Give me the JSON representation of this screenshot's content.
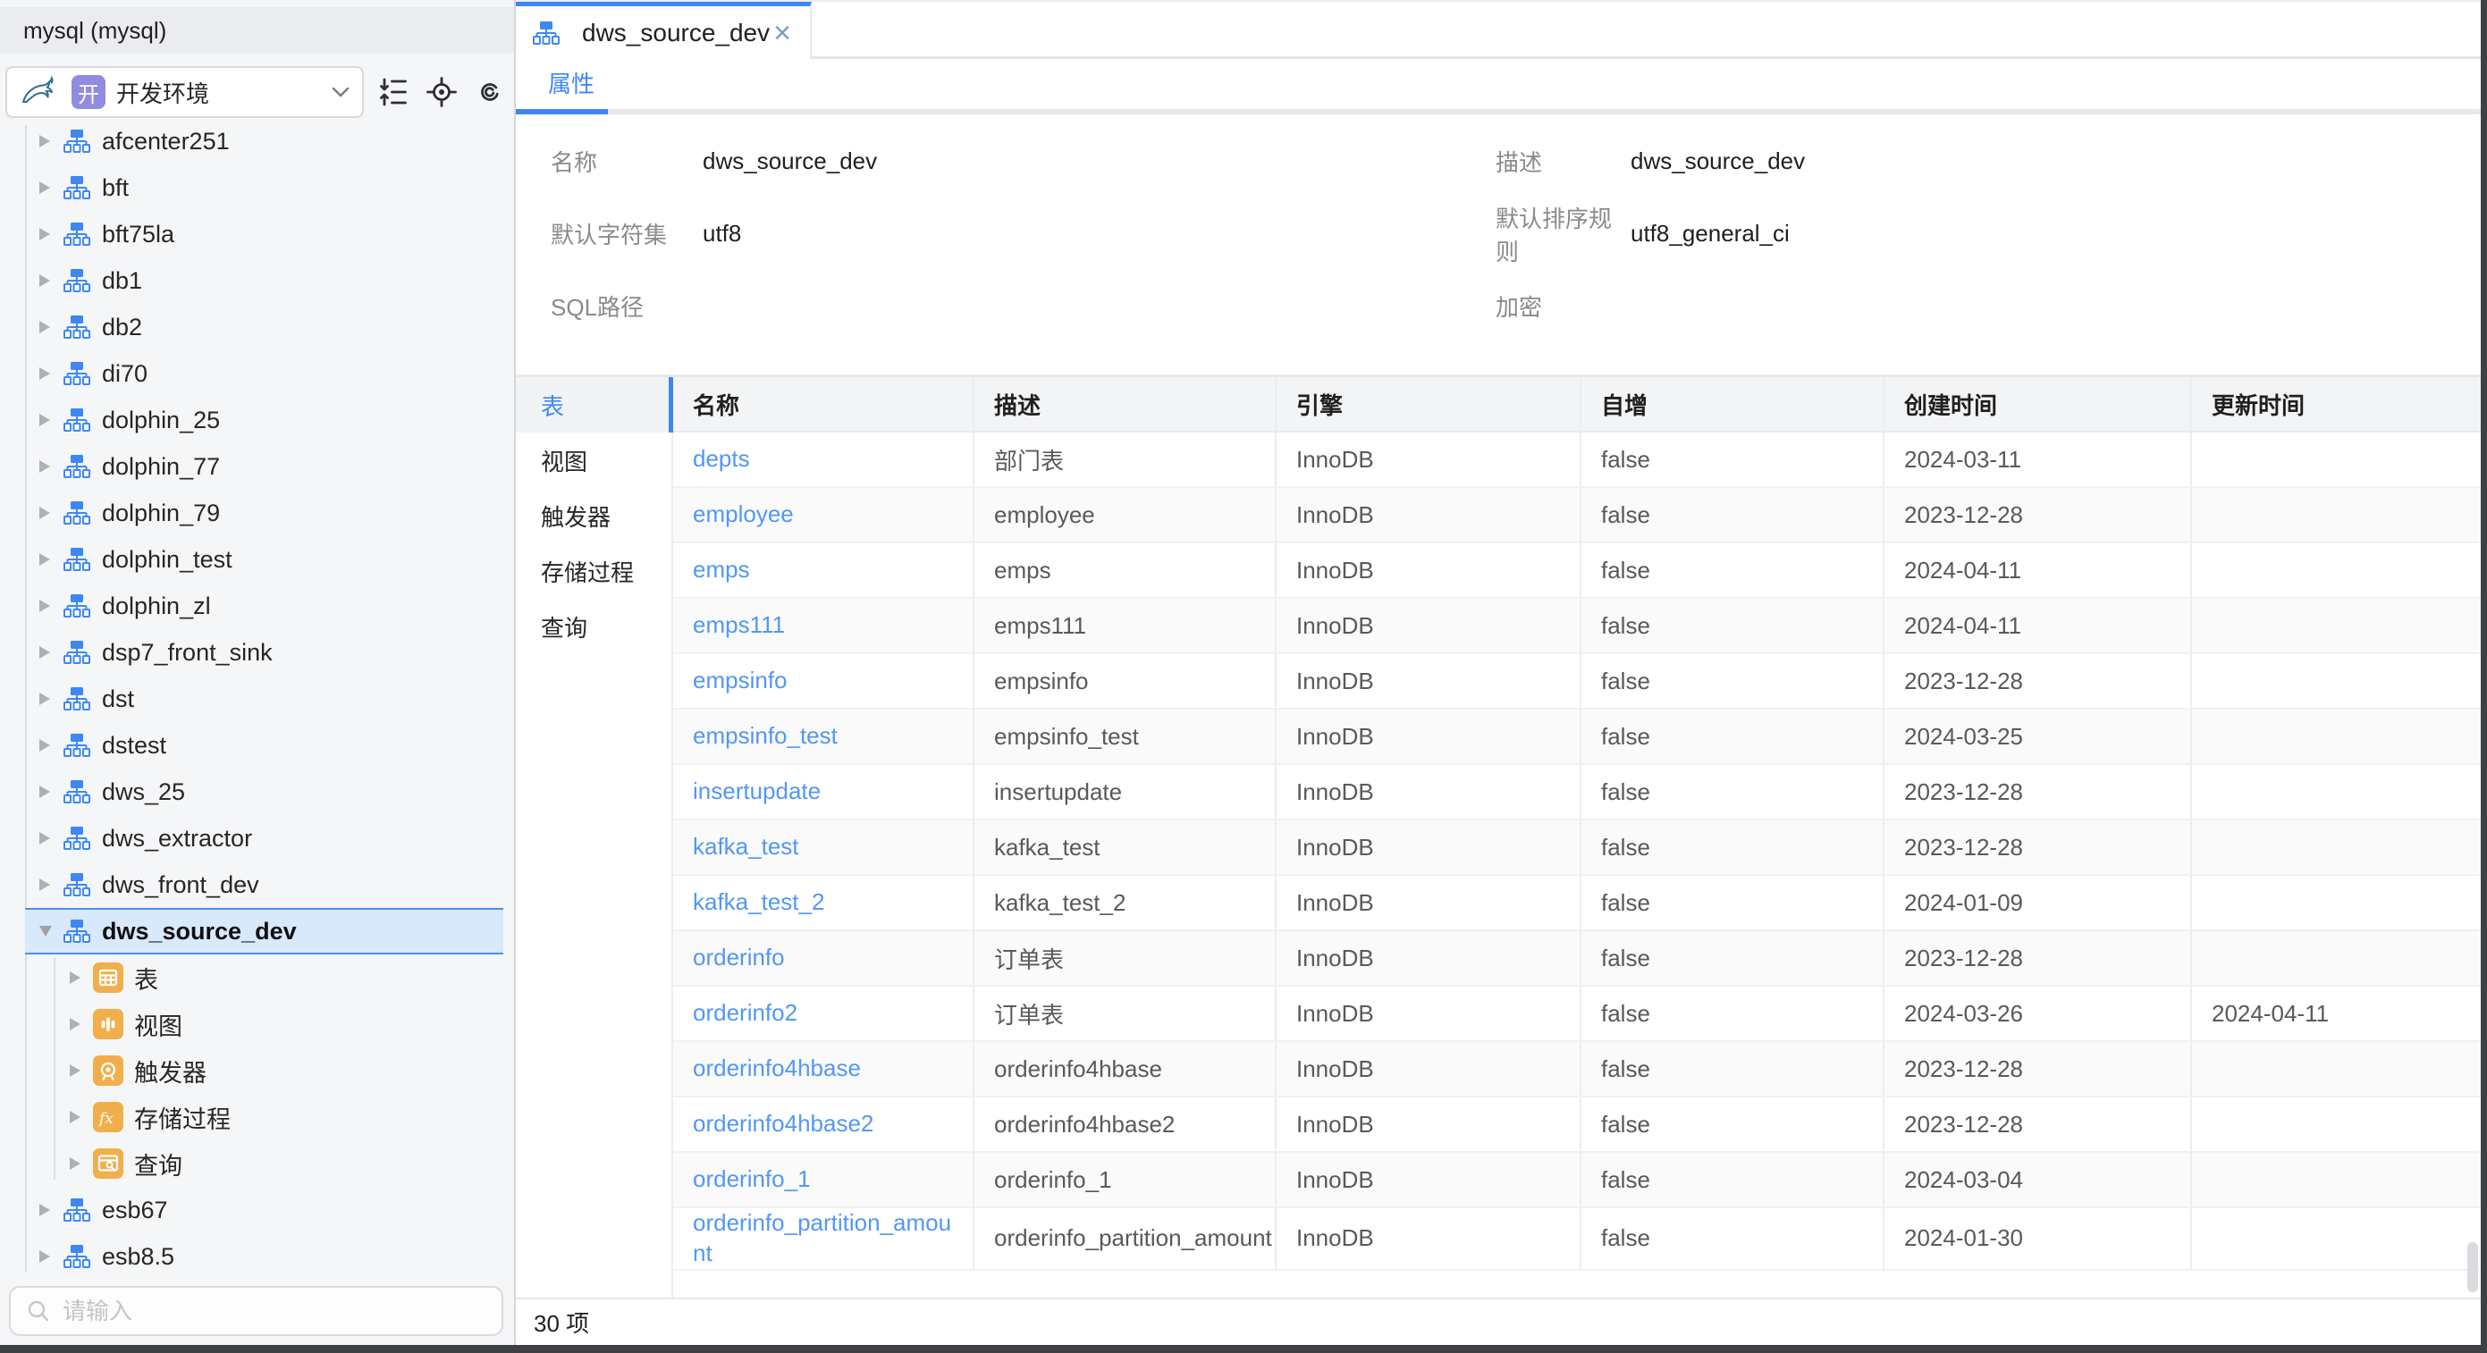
{
  "colors": {
    "accent": "#3D87F5",
    "link": "#5297F5",
    "selection_bg": "#D8E9FC",
    "icon_orange": "#F1AF4B",
    "badge_purple": "#918CE0"
  },
  "sidebar": {
    "header": "mysql (mysql)",
    "connection": {
      "badge": "开",
      "label": "开发环境"
    },
    "search_placeholder": "请输入",
    "tree": [
      {
        "label": "afcenter251",
        "level": 0,
        "icon": "db-icon",
        "caret": "right",
        "selected": false
      },
      {
        "label": "bft",
        "level": 0,
        "icon": "db-icon",
        "caret": "right",
        "selected": false
      },
      {
        "label": "bft75la",
        "level": 0,
        "icon": "db-icon",
        "caret": "right",
        "selected": false
      },
      {
        "label": "db1",
        "level": 0,
        "icon": "db-icon",
        "caret": "right",
        "selected": false
      },
      {
        "label": "db2",
        "level": 0,
        "icon": "db-icon",
        "caret": "right",
        "selected": false
      },
      {
        "label": "di70",
        "level": 0,
        "icon": "db-icon",
        "caret": "right",
        "selected": false
      },
      {
        "label": "dolphin_25",
        "level": 0,
        "icon": "db-icon",
        "caret": "right",
        "selected": false
      },
      {
        "label": "dolphin_77",
        "level": 0,
        "icon": "db-icon",
        "caret": "right",
        "selected": false
      },
      {
        "label": "dolphin_79",
        "level": 0,
        "icon": "db-icon",
        "caret": "right",
        "selected": false
      },
      {
        "label": "dolphin_test",
        "level": 0,
        "icon": "db-icon",
        "caret": "right",
        "selected": false
      },
      {
        "label": "dolphin_zl",
        "level": 0,
        "icon": "db-icon",
        "caret": "right",
        "selected": false
      },
      {
        "label": "dsp7_front_sink",
        "level": 0,
        "icon": "db-icon",
        "caret": "right",
        "selected": false
      },
      {
        "label": "dst",
        "level": 0,
        "icon": "db-icon",
        "caret": "right",
        "selected": false
      },
      {
        "label": "dstest",
        "level": 0,
        "icon": "db-icon",
        "caret": "right",
        "selected": false
      },
      {
        "label": "dws_25",
        "level": 0,
        "icon": "db-icon",
        "caret": "right",
        "selected": false
      },
      {
        "label": "dws_extractor",
        "level": 0,
        "icon": "db-icon",
        "caret": "right",
        "selected": false
      },
      {
        "label": "dws_front_dev",
        "level": 0,
        "icon": "db-icon",
        "caret": "right",
        "selected": false
      },
      {
        "label": "dws_source_dev",
        "level": 0,
        "icon": "db-icon",
        "caret": "down",
        "selected": true
      },
      {
        "label": "表",
        "level": 1,
        "icon": "tables-icon",
        "caret": "right",
        "selected": false
      },
      {
        "label": "视图",
        "level": 1,
        "icon": "views-icon",
        "caret": "right",
        "selected": false
      },
      {
        "label": "触发器",
        "level": 1,
        "icon": "triggers-icon",
        "caret": "right",
        "selected": false
      },
      {
        "label": "存储过程",
        "level": 1,
        "icon": "procedures-icon",
        "caret": "right",
        "selected": false
      },
      {
        "label": "查询",
        "level": 1,
        "icon": "queries-icon",
        "caret": "right",
        "selected": false
      },
      {
        "label": "esb67",
        "level": 0,
        "icon": "db-icon",
        "caret": "right",
        "selected": false
      },
      {
        "label": "esb8.5",
        "level": 0,
        "icon": "db-icon",
        "caret": "right",
        "selected": false
      }
    ]
  },
  "main": {
    "tab": {
      "label": "dws_source_dev"
    },
    "subtab": {
      "label": "属性"
    },
    "properties": {
      "rows": [
        [
          {
            "label": "名称",
            "value": "dws_source_dev"
          },
          {
            "label": "描述",
            "value": "dws_source_dev"
          }
        ],
        [
          {
            "label": "默认字符集",
            "value": "utf8"
          },
          {
            "label": "默认排序规则",
            "value": "utf8_general_ci"
          }
        ],
        [
          {
            "label": "SQL路径",
            "value": ""
          },
          {
            "label": "加密",
            "value": ""
          }
        ]
      ]
    },
    "side_tabs": [
      "表",
      "视图",
      "触发器",
      "存储过程",
      "查询"
    ],
    "active_side_tab": "表",
    "table": {
      "columns": [
        "名称",
        "描述",
        "引擎",
        "自增",
        "创建时间",
        "更新时间"
      ],
      "rows": [
        {
          "name": "depts",
          "desc": "部门表",
          "engine": "InnoDB",
          "autoinc": "false",
          "created": "2024-03-11",
          "updated": ""
        },
        {
          "name": "employee",
          "desc": "employee",
          "engine": "InnoDB",
          "autoinc": "false",
          "created": "2023-12-28",
          "updated": ""
        },
        {
          "name": "emps",
          "desc": "emps",
          "engine": "InnoDB",
          "autoinc": "false",
          "created": "2024-04-11",
          "updated": ""
        },
        {
          "name": "emps111",
          "desc": "emps111",
          "engine": "InnoDB",
          "autoinc": "false",
          "created": "2024-04-11",
          "updated": ""
        },
        {
          "name": "empsinfo",
          "desc": "empsinfo",
          "engine": "InnoDB",
          "autoinc": "false",
          "created": "2023-12-28",
          "updated": ""
        },
        {
          "name": "empsinfo_test",
          "desc": "empsinfo_test",
          "engine": "InnoDB",
          "autoinc": "false",
          "created": "2024-03-25",
          "updated": ""
        },
        {
          "name": "insertupdate",
          "desc": "insertupdate",
          "engine": "InnoDB",
          "autoinc": "false",
          "created": "2023-12-28",
          "updated": ""
        },
        {
          "name": "kafka_test",
          "desc": "kafka_test",
          "engine": "InnoDB",
          "autoinc": "false",
          "created": "2023-12-28",
          "updated": ""
        },
        {
          "name": "kafka_test_2",
          "desc": "kafka_test_2",
          "engine": "InnoDB",
          "autoinc": "false",
          "created": "2024-01-09",
          "updated": ""
        },
        {
          "name": "orderinfo",
          "desc": "订单表",
          "engine": "InnoDB",
          "autoinc": "false",
          "created": "2023-12-28",
          "updated": ""
        },
        {
          "name": "orderinfo2",
          "desc": "订单表",
          "engine": "InnoDB",
          "autoinc": "false",
          "created": "2024-03-26",
          "updated": "2024-04-11"
        },
        {
          "name": "orderinfo4hbase",
          "desc": "orderinfo4hbase",
          "engine": "InnoDB",
          "autoinc": "false",
          "created": "2023-12-28",
          "updated": ""
        },
        {
          "name": "orderinfo4hbase2",
          "desc": "orderinfo4hbase2",
          "engine": "InnoDB",
          "autoinc": "false",
          "created": "2023-12-28",
          "updated": ""
        },
        {
          "name": "orderinfo_1",
          "desc": "orderinfo_1",
          "engine": "InnoDB",
          "autoinc": "false",
          "created": "2024-03-04",
          "updated": ""
        },
        {
          "name": "orderinfo_partition_amount",
          "desc": "orderinfo_partition_amount",
          "engine": "InnoDB",
          "autoinc": "false",
          "created": "2024-01-30",
          "updated": ""
        }
      ]
    },
    "footer": {
      "count_label": "30 项"
    }
  }
}
